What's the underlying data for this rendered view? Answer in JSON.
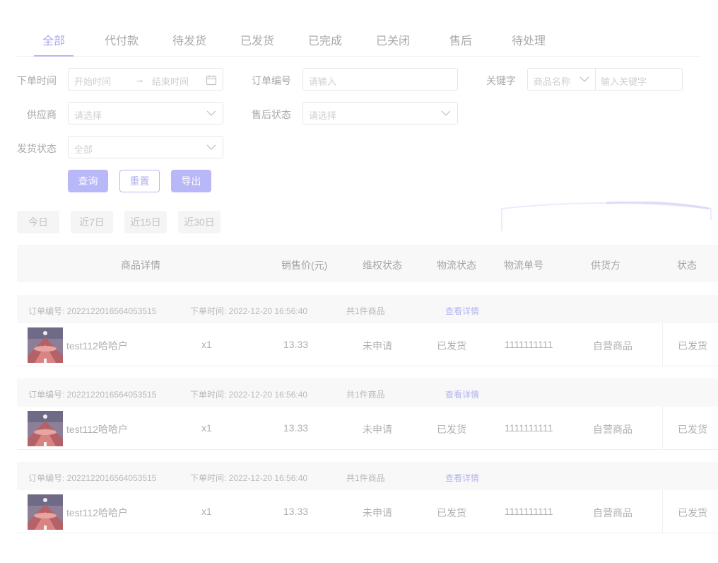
{
  "tabs": [
    {
      "label": "全部",
      "active": true
    },
    {
      "label": "代付款",
      "active": false
    },
    {
      "label": "待发货",
      "active": false
    },
    {
      "label": "已发货",
      "active": false
    },
    {
      "label": "已完成",
      "active": false
    },
    {
      "label": "已关闭",
      "active": false
    },
    {
      "label": "售后",
      "active": false
    },
    {
      "label": "待处理",
      "active": false
    }
  ],
  "filters": {
    "order_time": {
      "label": "下单时间",
      "start_placeholder": "开始时间",
      "arrow": "→",
      "end_placeholder": "结束时间"
    },
    "order_no": {
      "label": "订单编号",
      "placeholder": "请输入"
    },
    "keyword": {
      "label": "关键字",
      "type_value": "商品名称",
      "placeholder": "输入关键字"
    },
    "supplier": {
      "label": "供应商",
      "placeholder": "请选择"
    },
    "after_sale_status": {
      "label": "售后状态",
      "placeholder": "请选择"
    },
    "ship_status": {
      "label": "发货状态",
      "value": "全部"
    }
  },
  "actions": {
    "query": "查询",
    "reset": "重置",
    "export": "导出"
  },
  "quick_ranges": [
    "今日",
    "近7日",
    "近15日",
    "近30日"
  ],
  "table": {
    "headers": {
      "product": "商品详情",
      "price": "销售价(元)",
      "rights": "维权状态",
      "logistics": "物流状态",
      "tracking": "物流单号",
      "supplier": "供货方",
      "status": "状态"
    },
    "orders": [
      {
        "order_no_label": "订单编号: 2022122016564053515",
        "order_time_label": "下单时间: 2022-12-20 16:56:40",
        "item_count": "共1件商品",
        "detail_link": "查看详情",
        "product_name": "test112哈哈户",
        "qty": "x1",
        "price": "13.33",
        "rights_status": "未申请",
        "logistics_status": "已发货",
        "tracking_no": "1111111111",
        "supplier": "自营商品",
        "status": "已发货"
      },
      {
        "order_no_label": "订单编号: 2022122016564053515",
        "order_time_label": "下单时间: 2022-12-20 16:56:40",
        "item_count": "共1件商品",
        "detail_link": "查看详情",
        "product_name": "test112哈哈户",
        "qty": "x1",
        "price": "13.33",
        "rights_status": "未申请",
        "logistics_status": "已发货",
        "tracking_no": "1111111111",
        "supplier": "自营商品",
        "status": "已发货"
      },
      {
        "order_no_label": "订单编号: 2022122016564053515",
        "order_time_label": "下单时间: 2022-12-20 16:56:40",
        "item_count": "共1件商品",
        "detail_link": "查看详情",
        "product_name": "test112哈哈户",
        "qty": "x1",
        "price": "13.33",
        "rights_status": "未申请",
        "logistics_status": "已发货",
        "tracking_no": "1111111111",
        "supplier": "自营商品",
        "status": "已发货"
      }
    ]
  },
  "colors": {
    "accent": "#b8b7f7",
    "text_muted": "#b0b0b0",
    "header_bg": "#f8f8f8"
  }
}
